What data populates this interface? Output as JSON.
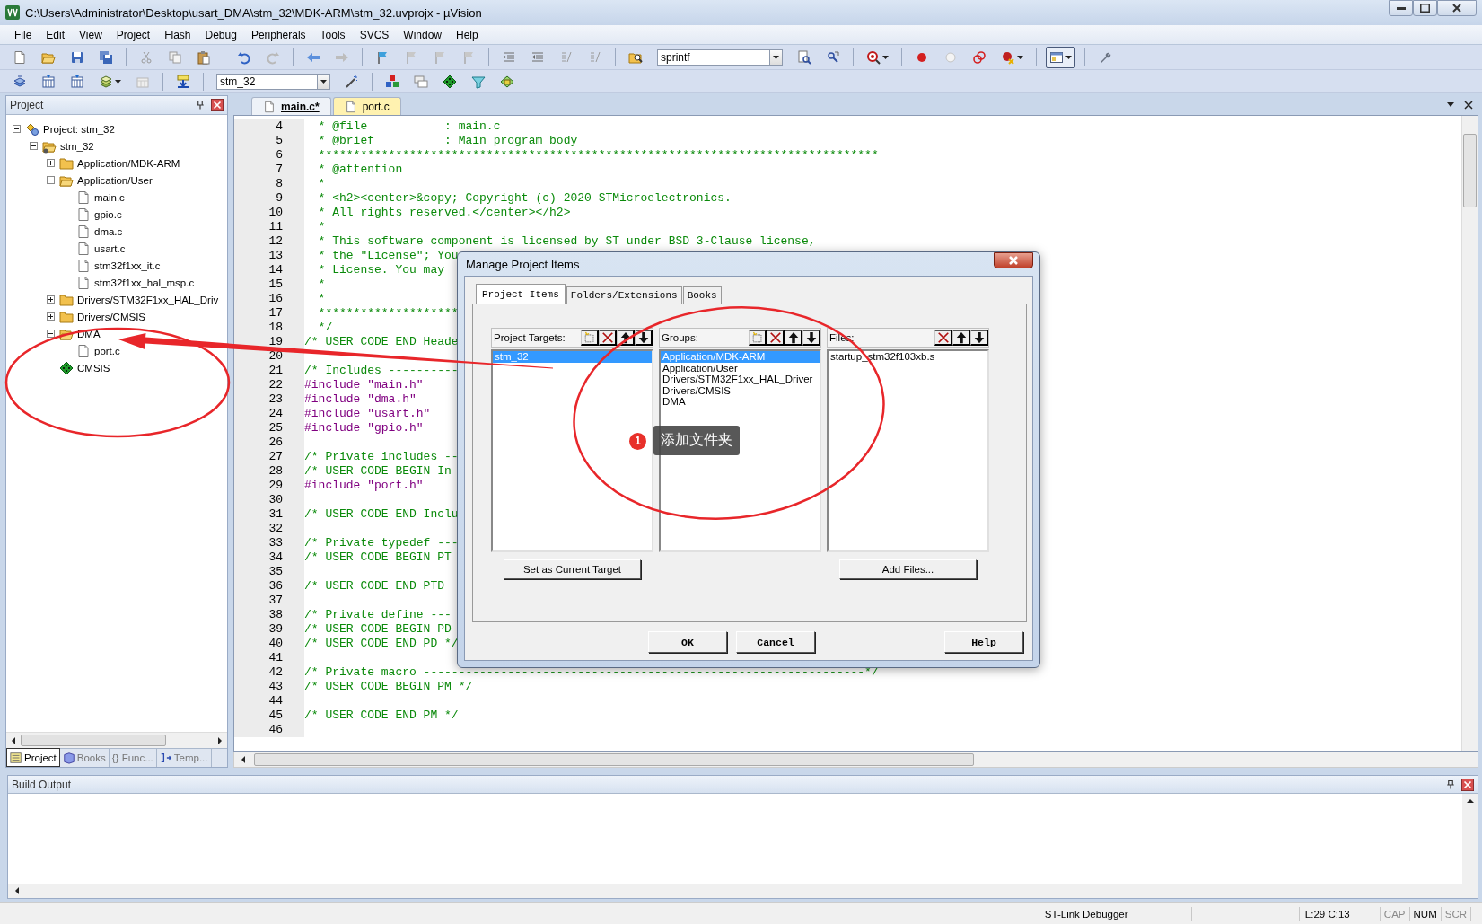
{
  "window": {
    "title": "C:\\Users\\Administrator\\Desktop\\usart_DMA\\stm_32\\MDK-ARM\\stm_32.uvprojx - µVision"
  },
  "menu": [
    "File",
    "Edit",
    "View",
    "Project",
    "Flash",
    "Debug",
    "Peripherals",
    "Tools",
    "SVCS",
    "Window",
    "Help"
  ],
  "toolbar": {
    "find_field": {
      "value": "sprintf"
    },
    "target_field": {
      "value": "stm_32"
    }
  },
  "project_panel": {
    "title": "Project",
    "tree": [
      {
        "label": "Project: stm_32",
        "kind": "project",
        "expanded": true,
        "children": [
          {
            "label": "stm_32",
            "kind": "target",
            "expanded": true,
            "children": [
              {
                "label": "Application/MDK-ARM",
                "kind": "folder",
                "expanded": false
              },
              {
                "label": "Application/User",
                "kind": "folder",
                "expanded": true,
                "children": [
                  {
                    "label": "main.c",
                    "kind": "file"
                  },
                  {
                    "label": "gpio.c",
                    "kind": "file"
                  },
                  {
                    "label": "dma.c",
                    "kind": "file"
                  },
                  {
                    "label": "usart.c",
                    "kind": "file"
                  },
                  {
                    "label": "stm32f1xx_it.c",
                    "kind": "file"
                  },
                  {
                    "label": "stm32f1xx_hal_msp.c",
                    "kind": "file"
                  }
                ]
              },
              {
                "label": "Drivers/STM32F1xx_HAL_Driv",
                "kind": "folder",
                "expanded": false
              },
              {
                "label": "Drivers/CMSIS",
                "kind": "folder",
                "expanded": false
              },
              {
                "label": "DMA",
                "kind": "folder",
                "expanded": true,
                "children": [
                  {
                    "label": "port.c",
                    "kind": "file"
                  }
                ]
              },
              {
                "label": "CMSIS",
                "kind": "component"
              }
            ]
          }
        ]
      }
    ],
    "tabs": [
      {
        "label": "Project",
        "kind": "project",
        "selected": true
      },
      {
        "label": "Books",
        "kind": "books",
        "selected": false
      },
      {
        "label": "{} Func...",
        "kind": "functions",
        "selected": false
      },
      {
        "label": "Temp...",
        "kind": "templates",
        "selected": false
      }
    ]
  },
  "editor": {
    "tabs": [
      {
        "label": "main.c*",
        "selected": true
      },
      {
        "label": "port.c",
        "selected": false
      }
    ],
    "lines": [
      {
        "number": "4",
        "kind": "comment",
        "text": "  * @file           : main.c"
      },
      {
        "number": "5",
        "kind": "comment",
        "text": "  * @brief          : Main program body"
      },
      {
        "number": "6",
        "kind": "comment",
        "text": "  ********************************************************************************"
      },
      {
        "number": "7",
        "kind": "comment",
        "text": "  * @attention"
      },
      {
        "number": "8",
        "kind": "comment",
        "text": "  *"
      },
      {
        "number": "9",
        "kind": "comment",
        "text": "  * <h2><center>&copy; Copyright (c) 2020 STMicroelectronics."
      },
      {
        "number": "10",
        "kind": "comment",
        "text": "  * All rights reserved.</center></h2>"
      },
      {
        "number": "11",
        "kind": "comment",
        "text": "  *"
      },
      {
        "number": "12",
        "kind": "comment",
        "text": "  * This software component is licensed by ST under BSD 3-Clause license,"
      },
      {
        "number": "13",
        "kind": "comment",
        "text": "  * the \"License\"; You"
      },
      {
        "number": "14",
        "kind": "comment",
        "text": "  * License. You may"
      },
      {
        "number": "15",
        "kind": "comment",
        "text": "  *"
      },
      {
        "number": "16",
        "kind": "comment",
        "text": "  *"
      },
      {
        "number": "17",
        "kind": "comment",
        "text": "  ********************"
      },
      {
        "number": "18",
        "kind": "comment",
        "text": "  */"
      },
      {
        "number": "19",
        "kind": "comment",
        "text": "/* USER CODE END Heade"
      },
      {
        "number": "20",
        "kind": "blank"
      },
      {
        "number": "21",
        "kind": "comment",
        "text": "/* Includes ----------"
      },
      {
        "number": "22",
        "kind": "include",
        "text": "#include \"main.h\""
      },
      {
        "number": "23",
        "kind": "include",
        "text": "#include \"dma.h\""
      },
      {
        "number": "24",
        "kind": "include",
        "text": "#include \"usart.h\""
      },
      {
        "number": "25",
        "kind": "include",
        "text": "#include \"gpio.h\""
      },
      {
        "number": "26",
        "kind": "blank"
      },
      {
        "number": "27",
        "kind": "comment",
        "text": "/* Private includes --"
      },
      {
        "number": "28",
        "kind": "comment",
        "text": "/* USER CODE BEGIN In"
      },
      {
        "number": "29",
        "kind": "include",
        "text": "#include \"port.h\""
      },
      {
        "number": "30",
        "kind": "blank"
      },
      {
        "number": "31",
        "kind": "comment",
        "text": "/* USER CODE END Inclu"
      },
      {
        "number": "32",
        "kind": "blank"
      },
      {
        "number": "33",
        "kind": "comment",
        "text": "/* Private typedef ---"
      },
      {
        "number": "34",
        "kind": "comment",
        "text": "/* USER CODE BEGIN PT"
      },
      {
        "number": "35",
        "kind": "blank"
      },
      {
        "number": "36",
        "kind": "comment",
        "text": "/* USER CODE END PTD"
      },
      {
        "number": "37",
        "kind": "blank"
      },
      {
        "number": "38",
        "kind": "comment",
        "text": "/* Private define ---"
      },
      {
        "number": "39",
        "kind": "comment",
        "text": "/* USER CODE BEGIN PD"
      },
      {
        "number": "40",
        "kind": "comment",
        "text": "/* USER CODE END PD */"
      },
      {
        "number": "41",
        "kind": "blank"
      },
      {
        "number": "42",
        "kind": "comment",
        "text": "/* Private macro ---------------------------------------------------------------*/"
      },
      {
        "number": "43",
        "kind": "comment",
        "text": "/* USER CODE BEGIN PM */"
      },
      {
        "number": "44",
        "kind": "blank"
      },
      {
        "number": "45",
        "kind": "comment",
        "text": "/* USER CODE END PM */"
      },
      {
        "number": "46",
        "kind": "blank"
      }
    ]
  },
  "dialog": {
    "title": "Manage Project Items",
    "tabs": [
      {
        "label": "Project Items",
        "selected": true
      },
      {
        "label": "Folders/Extensions",
        "selected": false
      },
      {
        "label": "Books",
        "selected": false
      }
    ],
    "lists": [
      {
        "header": "Project Targets:",
        "tools": [
          {
            "kind": "new"
          },
          {
            "kind": "delete"
          },
          {
            "kind": "up"
          },
          {
            "kind": "down"
          }
        ],
        "items": [
          {
            "label": "stm_32",
            "selected": true
          }
        ],
        "button": "Set as Current Target"
      },
      {
        "header": "Groups:",
        "tools": [
          {
            "kind": "new"
          },
          {
            "kind": "delete"
          },
          {
            "kind": "up"
          },
          {
            "kind": "down"
          }
        ],
        "items": [
          {
            "label": "Application/MDK-ARM",
            "selected": true
          },
          {
            "label": "Application/User",
            "selected": false
          },
          {
            "label": "Drivers/STM32F1xx_HAL_Driver",
            "selected": false
          },
          {
            "label": "Drivers/CMSIS",
            "selected": false
          },
          {
            "label": "DMA",
            "selected": false
          }
        ]
      },
      {
        "header": "Files:",
        "tools": [
          {
            "kind": "delete"
          },
          {
            "kind": "up"
          },
          {
            "kind": "down"
          }
        ],
        "items": [
          {
            "label": "startup_stm32f103xb.s",
            "selected": false
          }
        ],
        "button": "Add Files..."
      }
    ],
    "buttons": [
      "OK",
      "Cancel",
      "Help"
    ]
  },
  "build_output": {
    "title": "Build Output"
  },
  "status_bar": {
    "debugger": "ST-Link Debugger",
    "position": "L:29 C:13",
    "indicators": [
      {
        "label": "CAP",
        "on": false
      },
      {
        "label": "NUM",
        "on": true
      },
      {
        "label": "SCR",
        "on": false
      }
    ]
  },
  "annotation": {
    "badge": "1",
    "text": "添加文件夹"
  }
}
